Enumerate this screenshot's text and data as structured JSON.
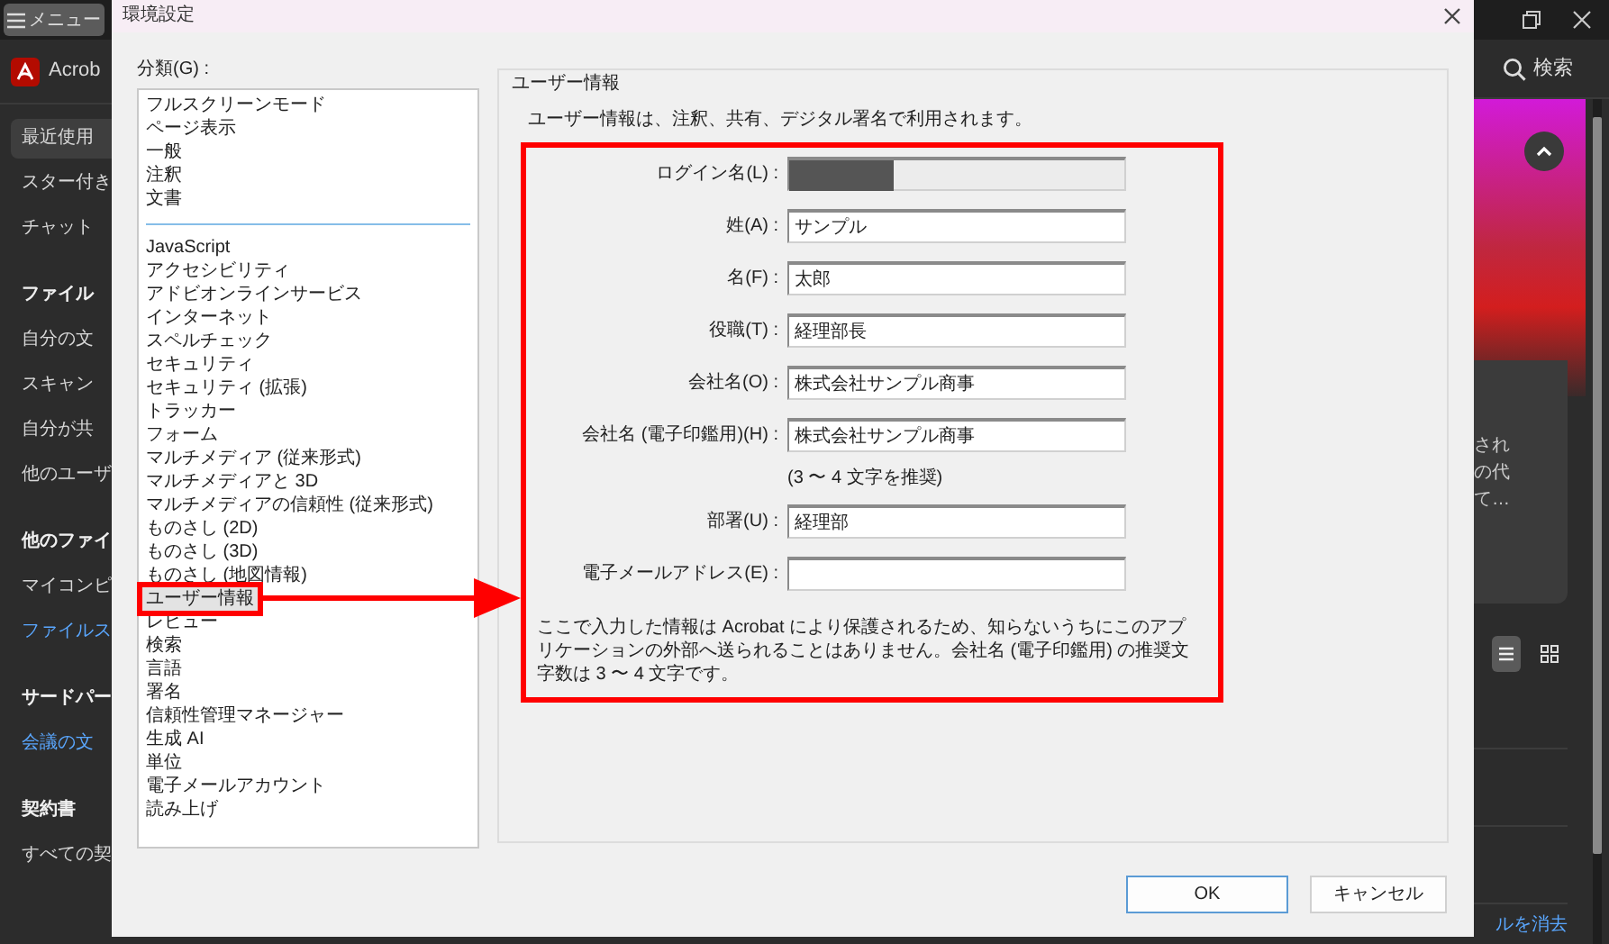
{
  "app": {
    "menu_button": "メニュー",
    "name": "Acrob"
  },
  "sidebar": {
    "items": [
      {
        "kind": "item",
        "label": "最近使用",
        "selected": true
      },
      {
        "kind": "item",
        "label": "スター付き",
        "selected": false
      },
      {
        "kind": "item",
        "label": "チャット",
        "selected": false
      },
      {
        "kind": "heading",
        "label": "ファイル"
      },
      {
        "kind": "item",
        "label": "自分の文",
        "selected": false
      },
      {
        "kind": "item",
        "label": "スキャン",
        "selected": false
      },
      {
        "kind": "item",
        "label": "自分が共",
        "selected": false
      },
      {
        "kind": "item",
        "label": "他のユーザ",
        "selected": false
      },
      {
        "kind": "heading",
        "label": "他のファイ"
      },
      {
        "kind": "item",
        "label": "マイコンピ",
        "selected": false
      },
      {
        "kind": "link",
        "label": "ファイルス",
        "selected": false
      },
      {
        "kind": "heading",
        "label": "サードパー"
      },
      {
        "kind": "link",
        "label": "会議の文",
        "selected": false
      },
      {
        "kind": "heading",
        "label": "契約書"
      },
      {
        "kind": "item",
        "label": "すべての契",
        "selected": false
      }
    ]
  },
  "dialog": {
    "title": "環境設定",
    "category_label": "分類(G) :",
    "category_groups": [
      [
        {
          "label": "フルスクリーンモード",
          "selected": false
        },
        {
          "label": "ページ表示",
          "selected": false
        },
        {
          "label": "一般",
          "selected": false
        },
        {
          "label": "注釈",
          "selected": false
        },
        {
          "label": "文書",
          "selected": false
        }
      ],
      [
        {
          "label": "JavaScript",
          "selected": false
        },
        {
          "label": "アクセシビリティ",
          "selected": false
        },
        {
          "label": "アドビオンラインサービス",
          "selected": false
        },
        {
          "label": "インターネット",
          "selected": false
        },
        {
          "label": "スペルチェック",
          "selected": false
        },
        {
          "label": "セキュリティ",
          "selected": false
        },
        {
          "label": "セキュリティ (拡張)",
          "selected": false
        },
        {
          "label": "トラッカー",
          "selected": false
        },
        {
          "label": "フォーム",
          "selected": false
        },
        {
          "label": "マルチメディア (従来形式)",
          "selected": false
        },
        {
          "label": "マルチメディアと 3D",
          "selected": false
        },
        {
          "label": "マルチメディアの信頼性 (従来形式)",
          "selected": false
        },
        {
          "label": "ものさし (2D)",
          "selected": false
        },
        {
          "label": "ものさし (3D)",
          "selected": false
        },
        {
          "label": "ものさし (地図情報)",
          "selected": false
        },
        {
          "label": "ユーザー情報",
          "selected": true
        },
        {
          "label": "レビュー",
          "selected": false
        },
        {
          "label": "検索",
          "selected": false
        },
        {
          "label": "言語",
          "selected": false
        },
        {
          "label": "署名",
          "selected": false
        },
        {
          "label": "信頼性管理マネージャー",
          "selected": false
        },
        {
          "label": "生成 AI",
          "selected": false
        },
        {
          "label": "単位",
          "selected": false
        },
        {
          "label": "電子メールアカウント",
          "selected": false
        },
        {
          "label": "読み上げ",
          "selected": false
        }
      ]
    ],
    "group_title": "ユーザー情報",
    "description": "ユーザー情報は、注釈、共有、デジタル署名で利用されます。",
    "rows": [
      {
        "kind": "field",
        "label": "ログイン名(L) :",
        "disabled": true,
        "redacted": true
      },
      {
        "kind": "field",
        "label": "姓(A) :",
        "value": "サンプル",
        "disabled": false,
        "redacted": false
      },
      {
        "kind": "field",
        "label": "名(F) :",
        "value": "太郎",
        "disabled": false,
        "redacted": false
      },
      {
        "kind": "field",
        "label": "役職(T) :",
        "value": "経理部長",
        "disabled": false,
        "redacted": false
      },
      {
        "kind": "field",
        "label": "会社名(O) :",
        "value": "株式会社サンプル商事",
        "disabled": false,
        "redacted": false
      },
      {
        "kind": "field",
        "label": "会社名 (電子印鑑用)(H) :",
        "value": "株式会社サンプル商事",
        "disabled": false,
        "redacted": false
      },
      {
        "kind": "hint",
        "text": "(3 〜 4 文字を推奨)"
      },
      {
        "kind": "field",
        "label": "部署(U) :",
        "value": "経理部",
        "disabled": false,
        "redacted": false
      },
      {
        "kind": "field",
        "label": "電子メールアドレス(E) :",
        "disabled": false,
        "redacted": false
      }
    ],
    "note": "ここで入力した情報は Acrobat により保護されるため、知らないうちにこのアプリケーションの外部へ送られることはありません。会社名 (電子印鑑用) の推奨文字数は 3 〜 4 文字です。",
    "buttons": [
      {
        "label": "OK",
        "default": true
      },
      {
        "label": "キャンセル",
        "default": false
      }
    ]
  },
  "annotations": {
    "highlight_selected_category": true,
    "arrow": true,
    "highlight_form": true
  },
  "right_panel": {
    "search_label": "検索",
    "card_lines": [
      "され",
      "の代",
      "て…"
    ],
    "view_buttons": [
      {
        "kind": "list",
        "selected": true
      },
      {
        "kind": "grid",
        "selected": false
      }
    ],
    "footer_link": "ルを消去"
  }
}
